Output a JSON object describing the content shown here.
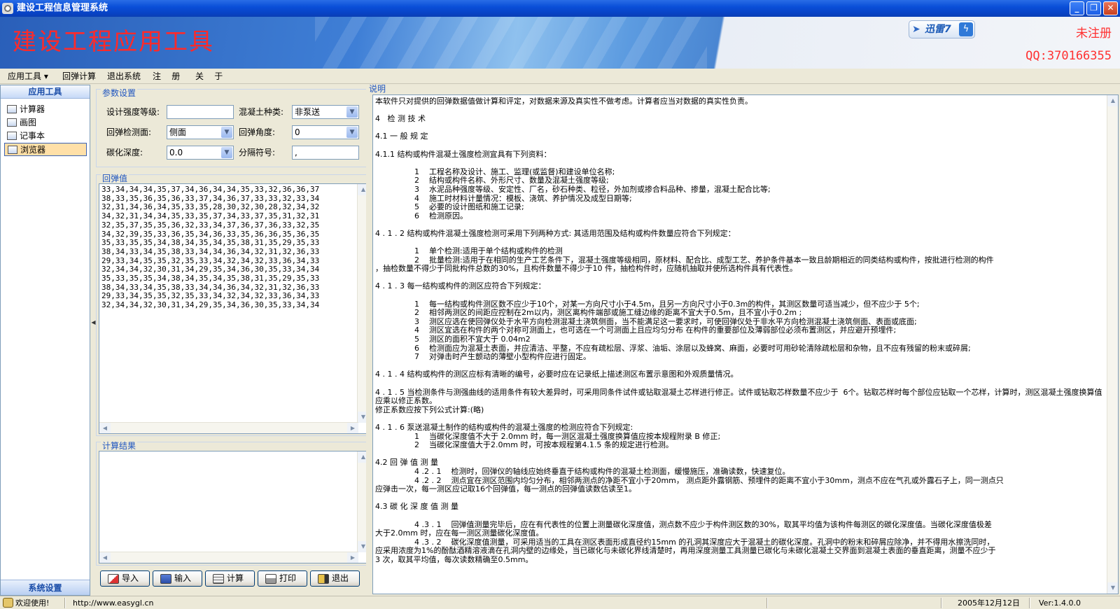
{
  "window": {
    "title": "建设工程信息管理系统",
    "min_glyph": "_",
    "max_glyph": "❐",
    "close_glyph": "✕"
  },
  "banner": {
    "title": "建设工程应用工具",
    "logo_text": "迅雷7",
    "unregistered": "未注册",
    "qq": "QQ:370166355"
  },
  "menu": {
    "items": [
      "应用工具 ▾",
      "回弹计算",
      "退出系统",
      "注    册",
      "关    于"
    ]
  },
  "nav": {
    "header": "应用工具",
    "items": [
      {
        "label": "计算器",
        "active": false
      },
      {
        "label": "画图",
        "active": false
      },
      {
        "label": "记事本",
        "active": false
      },
      {
        "label": "浏览器",
        "active": true
      }
    ],
    "footer": "系统设置"
  },
  "params": {
    "group_title": "参数设置",
    "strength_label": "设计强度等级:",
    "strength_value": "",
    "concrete_label": "混凝土种类:",
    "concrete_value": "非泵送",
    "surface_label": "回弹检测面:",
    "surface_value": "侧面",
    "angle_label": "回弹角度:",
    "angle_value": "0",
    "carbon_label": "碳化深度:",
    "carbon_value": "0.0",
    "separator_label": "分隔符号:",
    "separator_value": ","
  },
  "rebound": {
    "group_title": "回弹值",
    "rows": [
      "33,34,34,34,35,37,34,36,34,34,35,33,32,36,36,37",
      "38,33,35,36,35,36,33,37,34,36,37,33,33,32,33,34",
      "32,31,34,36,34,35,33,35,28,30,32,30,28,32,34,32",
      "34,32,31,34,34,35,33,35,37,34,33,37,35,31,32,31",
      "32,35,37,35,35,36,32,33,34,37,36,37,36,33,32,35",
      "34,32,39,35,33,36,35,34,36,33,35,36,36,35,36,35",
      "35,33,35,35,34,38,34,35,34,35,38,31,35,29,35,33",
      "38,34,33,34,35,38,33,34,34,36,34,32,31,32,36,33",
      "29,33,34,35,35,32,35,33,34,32,34,32,33,36,34,33",
      "32,34,34,32,30,31,34,29,35,34,36,30,35,33,34,34",
      "35,33,35,35,34,38,34,35,34,35,38,31,35,29,35,33",
      "38,34,33,34,35,38,33,34,34,36,34,32,31,32,36,33",
      "29,33,34,35,35,32,35,33,34,32,34,32,33,36,34,33",
      "32,34,34,32,30,31,34,29,35,34,36,30,35,33,34,34"
    ]
  },
  "result": {
    "group_title": "计算结果",
    "text": ""
  },
  "buttons": {
    "import": "导入",
    "input": "输入",
    "calc": "计算",
    "print": "打印",
    "exit": "退出"
  },
  "doc": {
    "title": "说明",
    "lines": [
      {
        "cls": "",
        "text": "本软件只对提供的回弹数据值做计算和评定，对数据来源及真实性不做考虑。计算者应当对数据的真实性负责。"
      },
      {
        "cls": "",
        "text": ""
      },
      {
        "cls": "",
        "text": "4   检 测 技 术"
      },
      {
        "cls": "",
        "text": ""
      },
      {
        "cls": "",
        "text": "4.1 一 般 规 定"
      },
      {
        "cls": "",
        "text": ""
      },
      {
        "cls": "",
        "text": "4.1.1 结构或构件混凝土强度检测宜具有下列资料："
      },
      {
        "cls": "",
        "text": ""
      },
      {
        "cls": "indent",
        "text": "1    工程名称及设计、施工、监理(或监督)和建设单位名称;"
      },
      {
        "cls": "indent",
        "text": "2    结构或构件名称、外形尺寸、数量及混凝土强度等级;"
      },
      {
        "cls": "indent",
        "text": "3    水泥品种强度等级、安定性、厂名，砂石种类、粒径，外加剂或掺合料品种、掺量，混凝土配合比等;"
      },
      {
        "cls": "indent",
        "text": "4    施工时材料计量情况：模板、浇筑、养护情况及成型日期等;"
      },
      {
        "cls": "indent",
        "text": "5    必要的设计图纸和施工记录;"
      },
      {
        "cls": "indent",
        "text": "6    检测原因。"
      },
      {
        "cls": "",
        "text": ""
      },
      {
        "cls": "",
        "text": "4 . 1 . 2 结构或构件混凝土强度检测可采用下列两种方式: 其适用范围及结构或构件数量应符合下列规定："
      },
      {
        "cls": "",
        "text": ""
      },
      {
        "cls": "indent",
        "text": "1    单个检测:适用于单个结构或构件的检测"
      },
      {
        "cls": "indent",
        "text": "2    批量检测:适用于在相同的生产工艺条件下，混凝土强度等级相同，原材料、配合比、成型工艺、养护条件基本一致且龄期相近的同类结构或构件，按批进行检测的构件"
      },
      {
        "cls": "",
        "text": "，抽检数量不得少于同批构件总数的30%，且构件数量不得少于10 件，抽检构件时，应随机抽取并使所选构件具有代表性。"
      },
      {
        "cls": "",
        "text": ""
      },
      {
        "cls": "",
        "text": "4 . 1 . 3 每一结构或构件的测区应符合下列规定："
      },
      {
        "cls": "",
        "text": ""
      },
      {
        "cls": "indent",
        "text": "1    每一结构或构件测区数不应少于10个，对某一方向尺寸小于4.5m，且另一方向尺寸小于0.3m的构件，其测区数量可适当减少，但不应少于 5个;"
      },
      {
        "cls": "indent",
        "text": "2    相邻两测区的间距应控制在2m以内，测区离构件端部或施工缝边缘的距离不宜大于0.5m，且不宜小于0.2m ;"
      },
      {
        "cls": "indent",
        "text": "3    测区应选在使回弹仪处于水平方向检测混凝土浇筑侧面，当不能满足这一要求时，可使回弹仪处于非水平方向检测混凝土浇筑侧面、表面或底面;"
      },
      {
        "cls": "indent",
        "text": "4    测区宜选在构件的两个对称可测面上，也可选在一个可测面上且应均匀分布 在构件的重要部位及薄弱部位必须布置测区，并应避开预埋件;"
      },
      {
        "cls": "indent",
        "text": "5    测区的面积不宜大于 0.04m2"
      },
      {
        "cls": "indent",
        "text": "6    检测面应为混凝土表面，并应清洁、平整，不应有疏松层、浮浆、油垢、涂层以及蜂窝、麻面，必要时可用砂轮清除疏松层和杂物，且不应有残留的粉末或碎屑;"
      },
      {
        "cls": "indent",
        "text": "7    对弹击时产生颤动的薄壁小型构件应进行固定。"
      },
      {
        "cls": "",
        "text": ""
      },
      {
        "cls": "",
        "text": "4 . 1 . 4 结构或构件的测区应标有清晰的编号，必要时应在记录纸上描述测区布置示意图和外观质量情况。"
      },
      {
        "cls": "",
        "text": ""
      },
      {
        "cls": "",
        "text": "4 . 1 . 5 当检测条件与测强曲线的适用条件有较大差异时，可采用同条件试件或钻取混凝土芯样进行修正。试件或钻取芯样数量不应少于  6个。钻取芯样时每个部位应钻取一个芯样，计算时，测区混凝土强度换算值应乘以修正系数。"
      },
      {
        "cls": "",
        "text": "修正系数应按下列公式计算:(略)"
      },
      {
        "cls": "",
        "text": ""
      },
      {
        "cls": "",
        "text": "4 . 1 . 6 泵送混凝土制作的结构或构件的混凝土强度的检测应符合下列规定:"
      },
      {
        "cls": "indent",
        "text": "1    当碳化深度值不大于 2.0mm 时，每一测区混凝土强度换算值应按本规程附录 B 修正;"
      },
      {
        "cls": "indent",
        "text": "2    当碳化深度值大于2.0mm 时，可按本规程第4.1.5 条的规定进行检测。"
      },
      {
        "cls": "",
        "text": ""
      },
      {
        "cls": "",
        "text": "4.2 回 弹 值 测 量"
      },
      {
        "cls": "sub",
        "text": "4 .2 . 1    检测时，回弹仪的轴线应始终垂直于结构或构件的混凝土检测面，缓慢施压，准确读数，快速复位。"
      },
      {
        "cls": "sub",
        "text": "4 .2 . 2    测点宜在测区范围内均匀分布，相邻两测点的净距不宜小于20mm， 测点距外露钢筋、预埋件的距离不宜小于30mm，测点不应在气孔或外露石子上，同一测点只"
      },
      {
        "cls": "",
        "text": "应弹击一次，每一测区应记取16个回弹值，每一测点的回弹值读数估读至1。"
      },
      {
        "cls": "",
        "text": ""
      },
      {
        "cls": "",
        "text": "4.3 碳 化 深 度 值 测 量"
      },
      {
        "cls": "",
        "text": ""
      },
      {
        "cls": "sub",
        "text": "4 .3 . 1    回弹值测量完毕后，应在有代表性的位置上测量碳化深度值，测点数不应少于构件测区数的30%，取其平均值为该构件每测区的碳化深度值。当碳化深度值极差"
      },
      {
        "cls": "",
        "text": "大于2.0mm 时，应在每一测区测量碳化深度值。"
      },
      {
        "cls": "sub",
        "text": "4 .3 . 2    碳化深度值测量，可采用适当的工具在测区表面形成直径约15mm 的孔洞其深度应大于混凝土的碳化深度。孔洞中的粉末和碎屑应除净，并不得用水擦洗同时，"
      },
      {
        "cls": "",
        "text": "应采用浓度为1%的酚酞酒精溶液滴在孔洞内壁的边缘处，当已碳化与未碳化界线清楚时，再用深度测量工具测量已碳化与未碳化混凝土交界面到混凝土表面的垂直距离，测量不应少于"
      },
      {
        "cls": "",
        "text": "3 次，取其平均值，每次读数精确至0.5mm。"
      }
    ]
  },
  "status": {
    "welcome": "欢迎使用!",
    "url": "http://www.easygl.cn",
    "date": "2005年12月12日",
    "version": "Ver:1.4.0.0"
  }
}
